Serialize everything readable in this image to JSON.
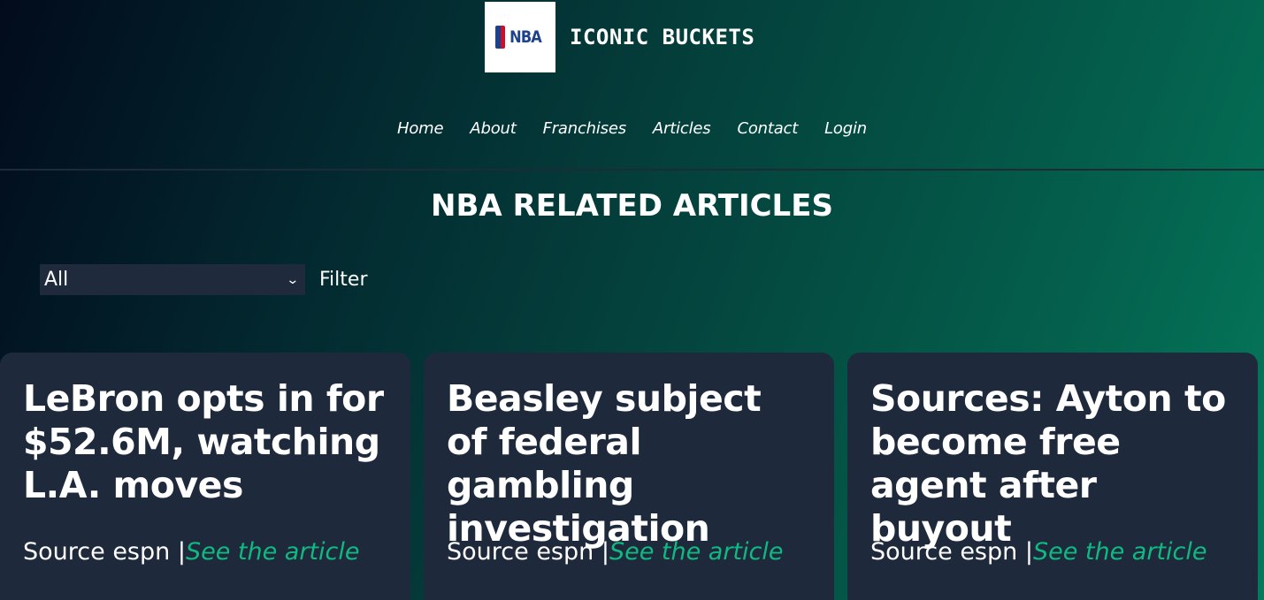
{
  "header": {
    "logo_text": "NBA",
    "site_title": "ICONIC BUCKETS"
  },
  "nav": {
    "items": [
      {
        "label": "Home"
      },
      {
        "label": "About"
      },
      {
        "label": "Franchises"
      },
      {
        "label": "Articles"
      },
      {
        "label": "Contact"
      },
      {
        "label": "Login"
      }
    ]
  },
  "main": {
    "title": "NBA RELATED ARTICLES",
    "filter": {
      "selected": "All",
      "label": "Filter"
    },
    "articles": [
      {
        "title": "LeBron opts in for $52.6M, watching L.A. moves",
        "source": "Source espn",
        "separator": "|",
        "link_text": "See the article"
      },
      {
        "title": "Beasley subject of federal gambling investigation",
        "source": "Source espn",
        "separator": "|",
        "link_text": "See the article"
      },
      {
        "title": "Sources: Ayton to become free agent after buyout",
        "source": "Source espn",
        "separator": "|",
        "link_text": "See the article"
      }
    ]
  },
  "colors": {
    "accent": "#10b981",
    "card_bg": "#1e293b",
    "nba_blue": "#1d428a",
    "nba_red": "#c8102e"
  }
}
